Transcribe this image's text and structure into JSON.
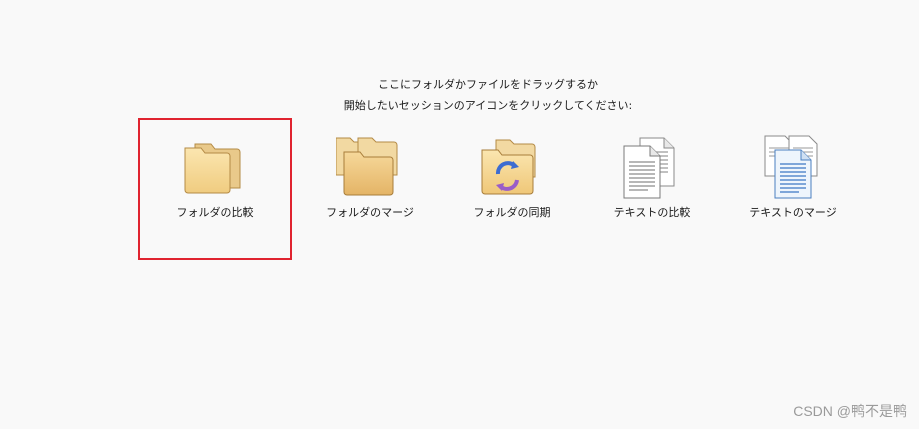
{
  "instructions": {
    "line1": "ここにフォルダかファイルをドラッグするか",
    "line2": "開始したいセッションのアイコンをクリックしてください:"
  },
  "sessions": [
    {
      "label": "フォルダの比較",
      "icon": "folder-icon",
      "selected": true
    },
    {
      "label": "フォルダのマージ",
      "icon": "folders-merge-icon",
      "selected": false
    },
    {
      "label": "フォルダの同期",
      "icon": "folder-sync-icon",
      "selected": false
    },
    {
      "label": "テキストの比較",
      "icon": "text-compare-icon",
      "selected": false
    },
    {
      "label": "テキストのマージ",
      "icon": "text-merge-icon",
      "selected": false
    }
  ],
  "watermark": "CSDN @鸭不是鸭",
  "colors": {
    "background": "#f9f9f9",
    "selection": "#e0232f"
  }
}
